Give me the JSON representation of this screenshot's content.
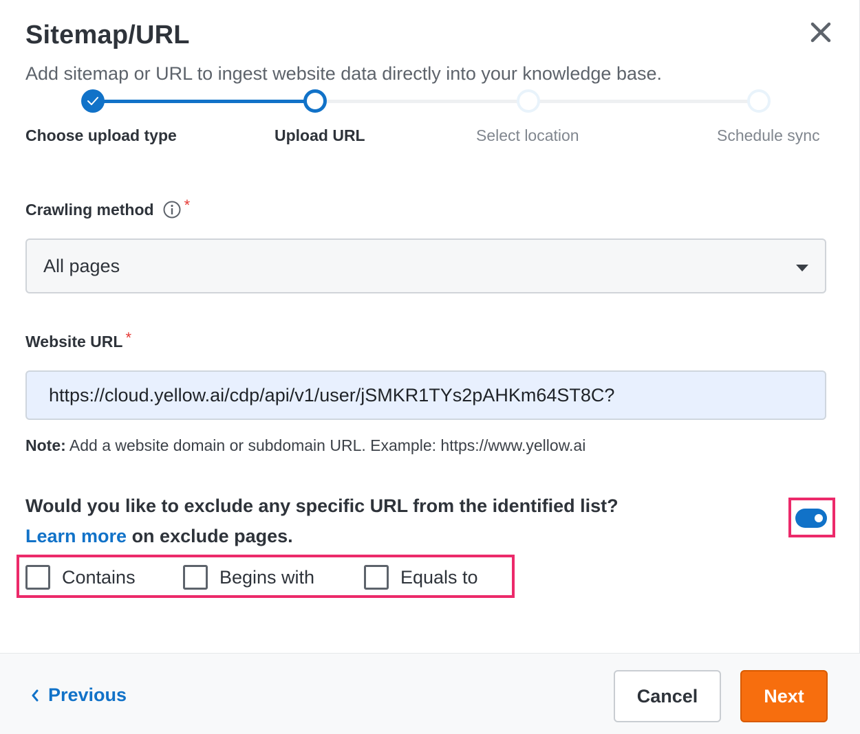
{
  "dialog": {
    "title": "Sitemap/URL",
    "subtitle": "Add sitemap or URL to ingest website data directly into your knowledge base.",
    "close_icon": "close-icon"
  },
  "stepper": {
    "steps": [
      {
        "label": "Choose upload type",
        "state": "completed"
      },
      {
        "label": "Upload URL",
        "state": "active"
      },
      {
        "label": "Select location",
        "state": "pending"
      },
      {
        "label": "Schedule sync",
        "state": "pending"
      }
    ]
  },
  "crawling": {
    "label": "Crawling method",
    "required_mark": "*",
    "info_icon": "info-icon",
    "selected": "All pages"
  },
  "website_url": {
    "label": "Website URL",
    "required_mark": "*",
    "value": "https://cloud.yellow.ai/cdp/api/v1/user/jSMKR1TYs2pAHKm64ST8C?"
  },
  "note": {
    "prefix": "Note:",
    "text": " Add a website domain or subdomain URL. Example: https://www.yellow.ai"
  },
  "exclude": {
    "question": "Would you like to exclude any specific URL from the identified list?",
    "learn_more": "Learn more",
    "learn_suffix": " on exclude pages.",
    "toggle_on": true,
    "options": [
      {
        "label": "Contains",
        "checked": false
      },
      {
        "label": "Begins with",
        "checked": false
      },
      {
        "label": "Equals to",
        "checked": false
      }
    ]
  },
  "footer": {
    "previous": "Previous",
    "cancel": "Cancel",
    "next": "Next"
  },
  "colors": {
    "primary": "#1172c8",
    "next_button": "#f76e0e",
    "highlight": "#ec2a6a",
    "required": "#e53935"
  }
}
